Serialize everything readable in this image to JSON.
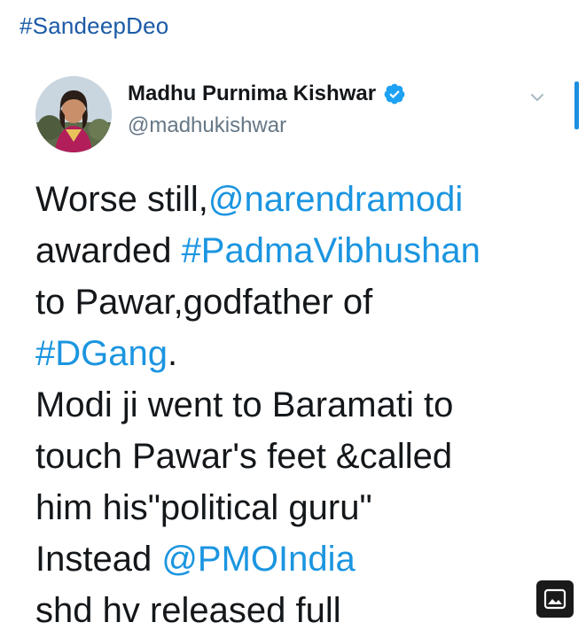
{
  "header": {
    "hashtag": "#SandeepDeo"
  },
  "tweet": {
    "author": {
      "display_name": "Madhu Purnima Kishwar",
      "handle": "@madhukishwar",
      "verified": true
    },
    "lines": [
      {
        "parts": [
          {
            "text": "Worse still,",
            "type": "text"
          },
          {
            "text": "@narendramodi",
            "type": "link"
          }
        ]
      },
      {
        "parts": [
          {
            "text": "awarded ",
            "type": "text"
          },
          {
            "text": "#PadmaVibhushan",
            "type": "link"
          }
        ]
      },
      {
        "parts": [
          {
            "text": "to Pawar,godfather of",
            "type": "text"
          }
        ]
      },
      {
        "parts": [
          {
            "text": "#DGang",
            "type": "link"
          },
          {
            "text": ".",
            "type": "text"
          }
        ]
      },
      {
        "parts": [
          {
            "text": "Modi ji went to Baramati to",
            "type": "text"
          }
        ]
      },
      {
        "parts": [
          {
            "text": "touch Pawar's feet &called",
            "type": "text"
          }
        ]
      },
      {
        "parts": [
          {
            "text": "him his\"political guru\"",
            "type": "text"
          }
        ]
      },
      {
        "parts": [
          {
            "text": "Instead ",
            "type": "text"
          },
          {
            "text": "@PMOIndia",
            "type": "link"
          }
        ]
      },
      {
        "parts": [
          {
            "text": "shd hv released full",
            "type": "text"
          }
        ]
      }
    ]
  },
  "icons": {
    "verified": "verified-badge-icon",
    "caret": "chevron-down-icon",
    "image": "image-icon"
  },
  "colors": {
    "link": "#1b95e0",
    "hashtag_header": "#1a5aa6",
    "text": "#14171a",
    "handle": "#657786",
    "scroll_indicator": "#1d8fe0"
  }
}
